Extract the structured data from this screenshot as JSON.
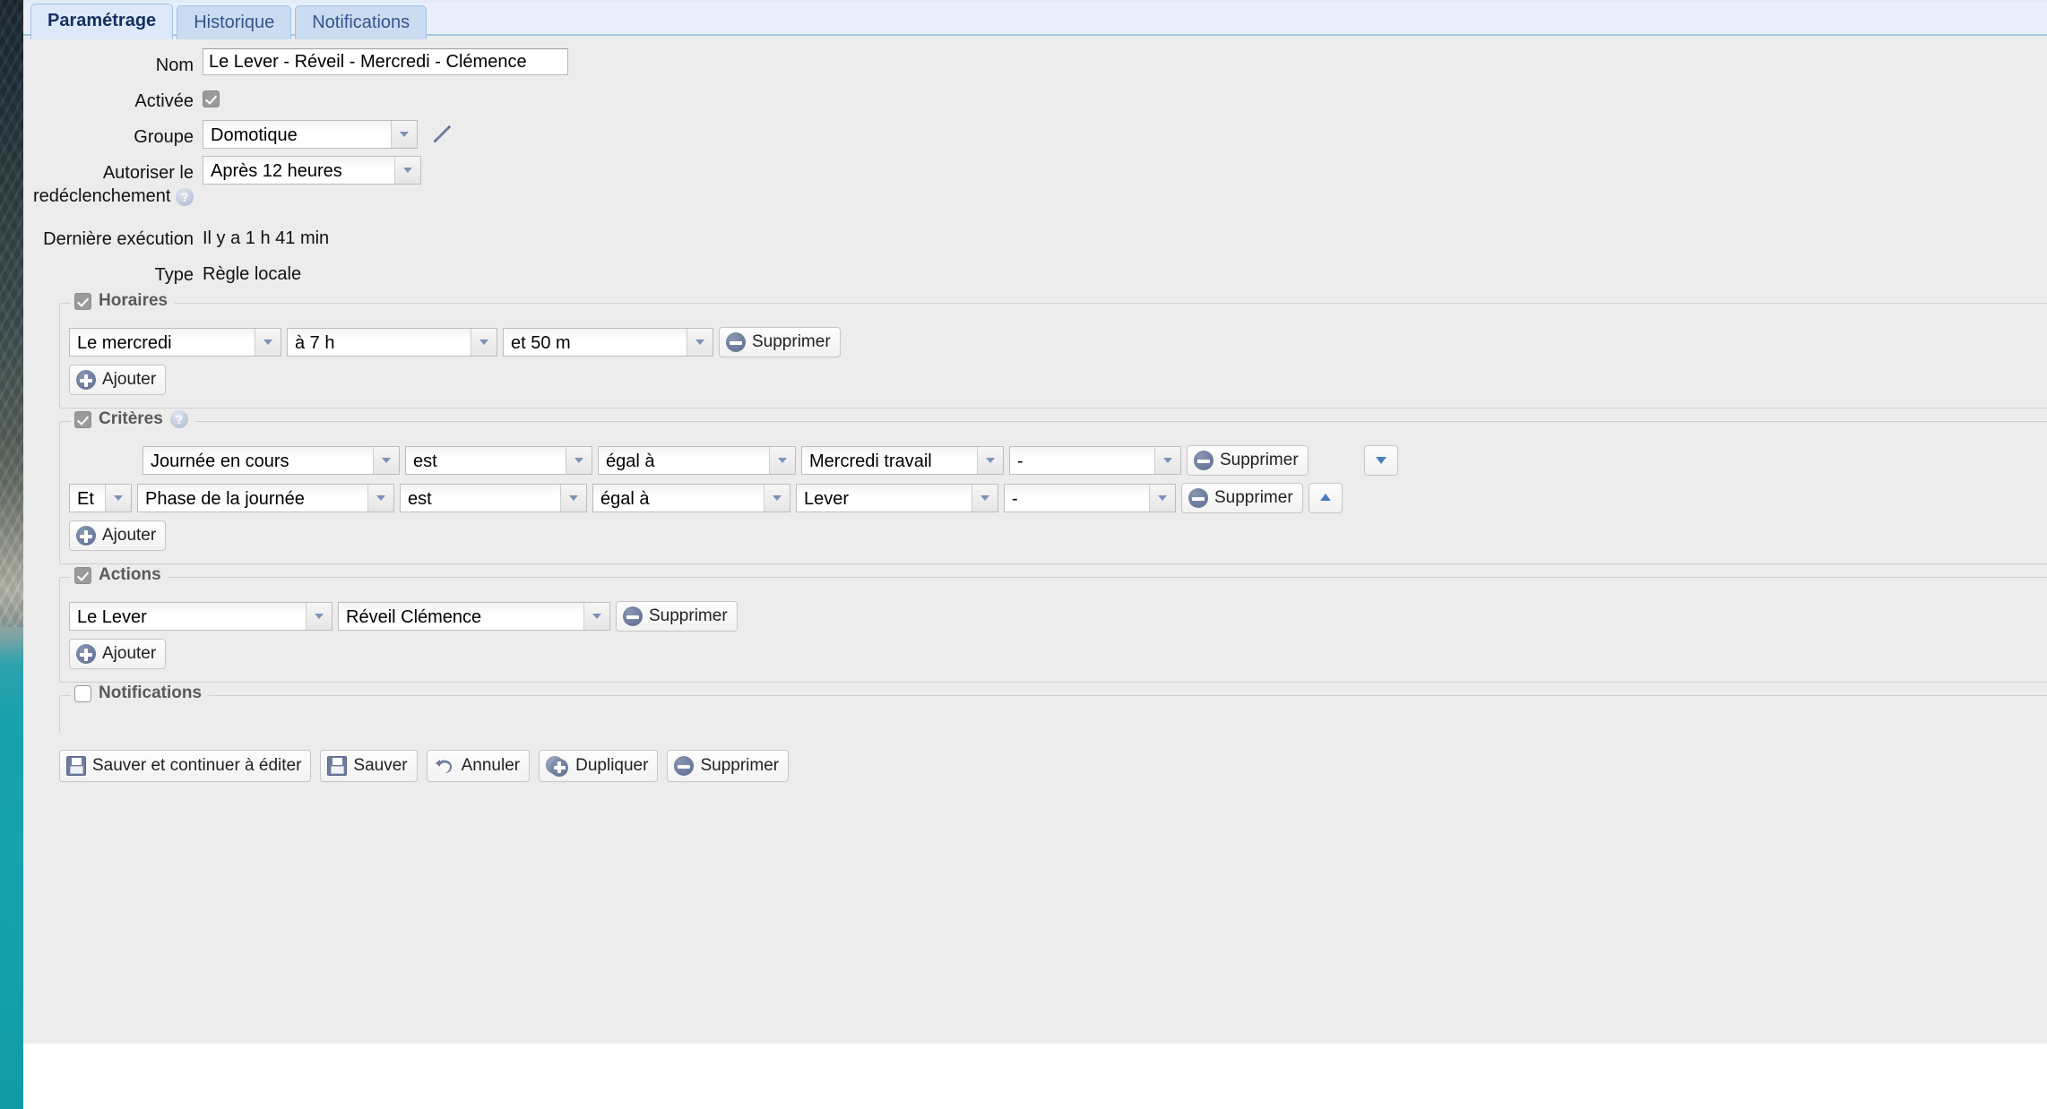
{
  "tabs": [
    {
      "label": "Paramétrage",
      "active": true
    },
    {
      "label": "Historique",
      "active": false
    },
    {
      "label": "Notifications",
      "active": false
    }
  ],
  "form": {
    "name": {
      "label": "Nom",
      "value": "Le Lever - Réveil - Mercredi - Clémence"
    },
    "enabled": {
      "label": "Activée",
      "checked": true
    },
    "group": {
      "label": "Groupe",
      "value": "Domotique"
    },
    "retrigger": {
      "label_line1": "Autoriser le",
      "label_line2": "redéclenchement",
      "help": "?",
      "value": "Après 12 heures"
    },
    "last_run": {
      "label": "Dernière exécution",
      "value": "Il y a 1 h 41 min"
    },
    "type": {
      "label": "Type",
      "value": "Règle locale"
    }
  },
  "schedules": {
    "legend": "Horaires",
    "enabled": true,
    "rows": [
      {
        "day": "Le mercredi",
        "hour": "à 7 h",
        "minute": "et 50 m",
        "delete_label": "Supprimer"
      }
    ],
    "add_label": "Ajouter"
  },
  "criteria": {
    "legend": "Critères",
    "enabled": true,
    "help": "?",
    "rows": [
      {
        "conjunction": "",
        "subject": "Journée en cours",
        "verb": "est",
        "operator": "égal à",
        "value": "Mercredi travail",
        "extra": "-",
        "delete_label": "Supprimer",
        "move": "down"
      },
      {
        "conjunction": "Et",
        "subject": "Phase de la journée",
        "verb": "est",
        "operator": "égal à",
        "value": "Lever",
        "extra": "-",
        "delete_label": "Supprimer",
        "move": "up"
      }
    ],
    "add_label": "Ajouter"
  },
  "actions": {
    "legend": "Actions",
    "enabled": true,
    "rows": [
      {
        "target": "Le Lever",
        "command": "Réveil Clémence",
        "delete_label": "Supprimer"
      }
    ],
    "add_label": "Ajouter"
  },
  "notifications": {
    "legend": "Notifications",
    "enabled": false
  },
  "toolbar": {
    "save_continue": "Sauver et continuer à éditer",
    "save": "Sauver",
    "cancel": "Annuler",
    "duplicate": "Dupliquer",
    "delete": "Supprimer"
  },
  "colors": {
    "tab_active_bg": "#dde9fa",
    "tab_text": "#33558f",
    "panel_bg": "#ececec",
    "icon_blue": "#6d7c9d",
    "arrow_blue": "#4a7ec0"
  }
}
